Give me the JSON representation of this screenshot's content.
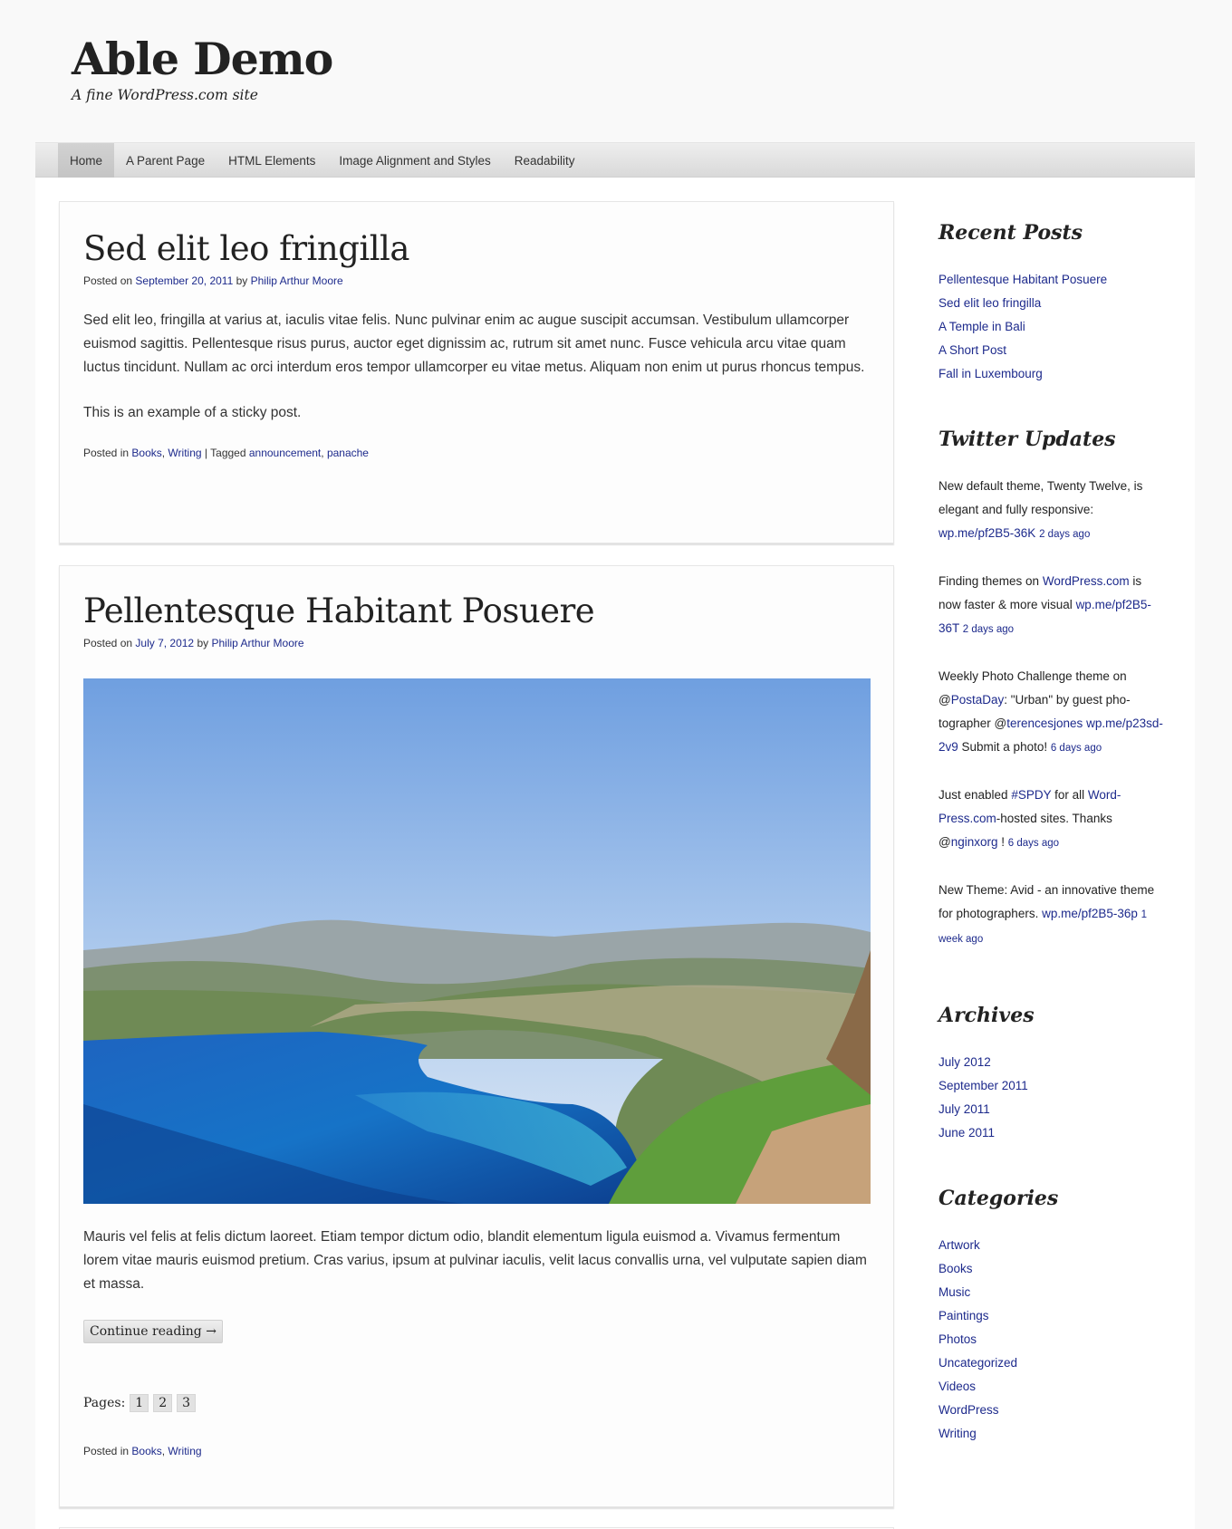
{
  "site": {
    "title": "Able Demo",
    "description": "A fine WordPress.com site"
  },
  "nav": {
    "items": [
      {
        "label": "Home",
        "active": true
      },
      {
        "label": "A Parent Page"
      },
      {
        "label": "HTML Elements"
      },
      {
        "label": "Image Alignment and Styles"
      },
      {
        "label": "Readability"
      }
    ]
  },
  "posts": [
    {
      "title": "Sed elit leo fringilla",
      "meta": {
        "posted_on": "Posted on",
        "date": "September 20, 2011",
        "by": "by",
        "author": "Philip Arthur Moore"
      },
      "paragraphs": [
        "Sed elit leo, fringilla at varius at, iaculis vitae felis. Nunc pulvinar enim ac augue suscipit accumsan. Vestibulum ullamcor­per euismod sagittis. Pellentesque risus purus, auctor eget dignissim ac, rutrum sit amet nunc. Fusce vehicula arcu vitae quam luctus tincidunt. Nullam ac orci interdum eros tempor ullamcorper eu vitae metus. Aliquam non enim ut purus rhon­cus tempus.",
        "This is an example of a sticky post."
      ],
      "footer": {
        "posted_in": "Posted in",
        "categories": [
          "Books",
          "Writing"
        ],
        "separator": "|",
        "tagged": "Tagged",
        "tags": [
          "announcement",
          "panache"
        ]
      }
    },
    {
      "title": "Pellentesque Habitant Posuere",
      "meta": {
        "posted_on": "Posted on",
        "date": "July 7, 2012",
        "by": "by",
        "author": "Philip Arthur Moore"
      },
      "image_alt": "Aerial view of a coastal bay with blue water, green hills and a town",
      "paragraphs": [
        "Mauris vel felis at felis dictum laoreet. Etiam tempor dictum odio, blandit elementum ligula euismod a. Vivamus fermentum lorem vitae mauris euismod pretium. Cras varius, ipsum at pulvinar iaculis, velit lacus convallis urna, vel vulputate sapien diam et massa."
      ],
      "continue_label": "Continue reading →",
      "pages_label": "Pages:",
      "pages": [
        "1",
        "2",
        "3"
      ],
      "footer": {
        "posted_in": "Posted in",
        "categories": [
          "Books",
          "Writing"
        ]
      }
    }
  ],
  "sidebar": {
    "recent_posts": {
      "title": "Recent Posts",
      "items": [
        "Pellentesque Habitant Posuere",
        "Sed elit leo fringilla",
        "A Temple in Bali",
        "A Short Post",
        "Fall in Luxembourg"
      ]
    },
    "twitter": {
      "title": "Twitter Updates",
      "tweets": [
        {
          "parts": [
            {
              "t": "New default theme, Twenty Twelve, is elegant and fully responsive: "
            },
            {
              "t": "wp.me/pf2B5-36K",
              "link": true
            },
            {
              "t": " "
            }
          ],
          "ago": "2 days ago"
        },
        {
          "parts": [
            {
              "t": "Finding themes on "
            },
            {
              "t": "WordPress.com",
              "link": true
            },
            {
              "t": " is now faster & more visual "
            },
            {
              "t": "wp.me/pf2B5-36T",
              "link": true
            },
            {
              "t": " "
            }
          ],
          "ago": "2 days ago"
        },
        {
          "parts": [
            {
              "t": "Weekly Photo Challenge theme on @"
            },
            {
              "t": "PostaDay",
              "link": true
            },
            {
              "t": ": \"Urban\" by guest pho­tographer @"
            },
            {
              "t": "terencesjones",
              "link": true
            },
            {
              "t": " "
            },
            {
              "t": "wp.me/p23sd-2v9",
              "link": true
            },
            {
              "t": " Submit a photo! "
            }
          ],
          "ago": "6 days ago"
        },
        {
          "parts": [
            {
              "t": "Just enabled "
            },
            {
              "t": "#SPDY",
              "link": true
            },
            {
              "t": " for all "
            },
            {
              "t": "Word­Press.com",
              "link": true
            },
            {
              "t": "-hosted sites. Thanks @"
            },
            {
              "t": "nginxorg",
              "link": true
            },
            {
              "t": " ! "
            }
          ],
          "ago": "6 days ago"
        },
        {
          "parts": [
            {
              "t": "New Theme: Avid - an innovative theme for photographers. "
            },
            {
              "t": "wp.me/pf2B5-36p",
              "link": true
            },
            {
              "t": " "
            }
          ],
          "ago": "1 week ago"
        }
      ]
    },
    "archives": {
      "title": "Archives",
      "items": [
        "July 2012",
        "September 2011",
        "July 2011",
        "June 2011"
      ]
    },
    "categories": {
      "title": "Categories",
      "items": [
        "Artwork",
        "Books",
        "Music",
        "Paintings",
        "Photos",
        "Uncategorized",
        "Videos",
        "WordPress",
        "Writing"
      ]
    }
  },
  "colors": {
    "link": "#1d2a8c",
    "text": "#222222",
    "page_bg": "#f9f9f9"
  }
}
